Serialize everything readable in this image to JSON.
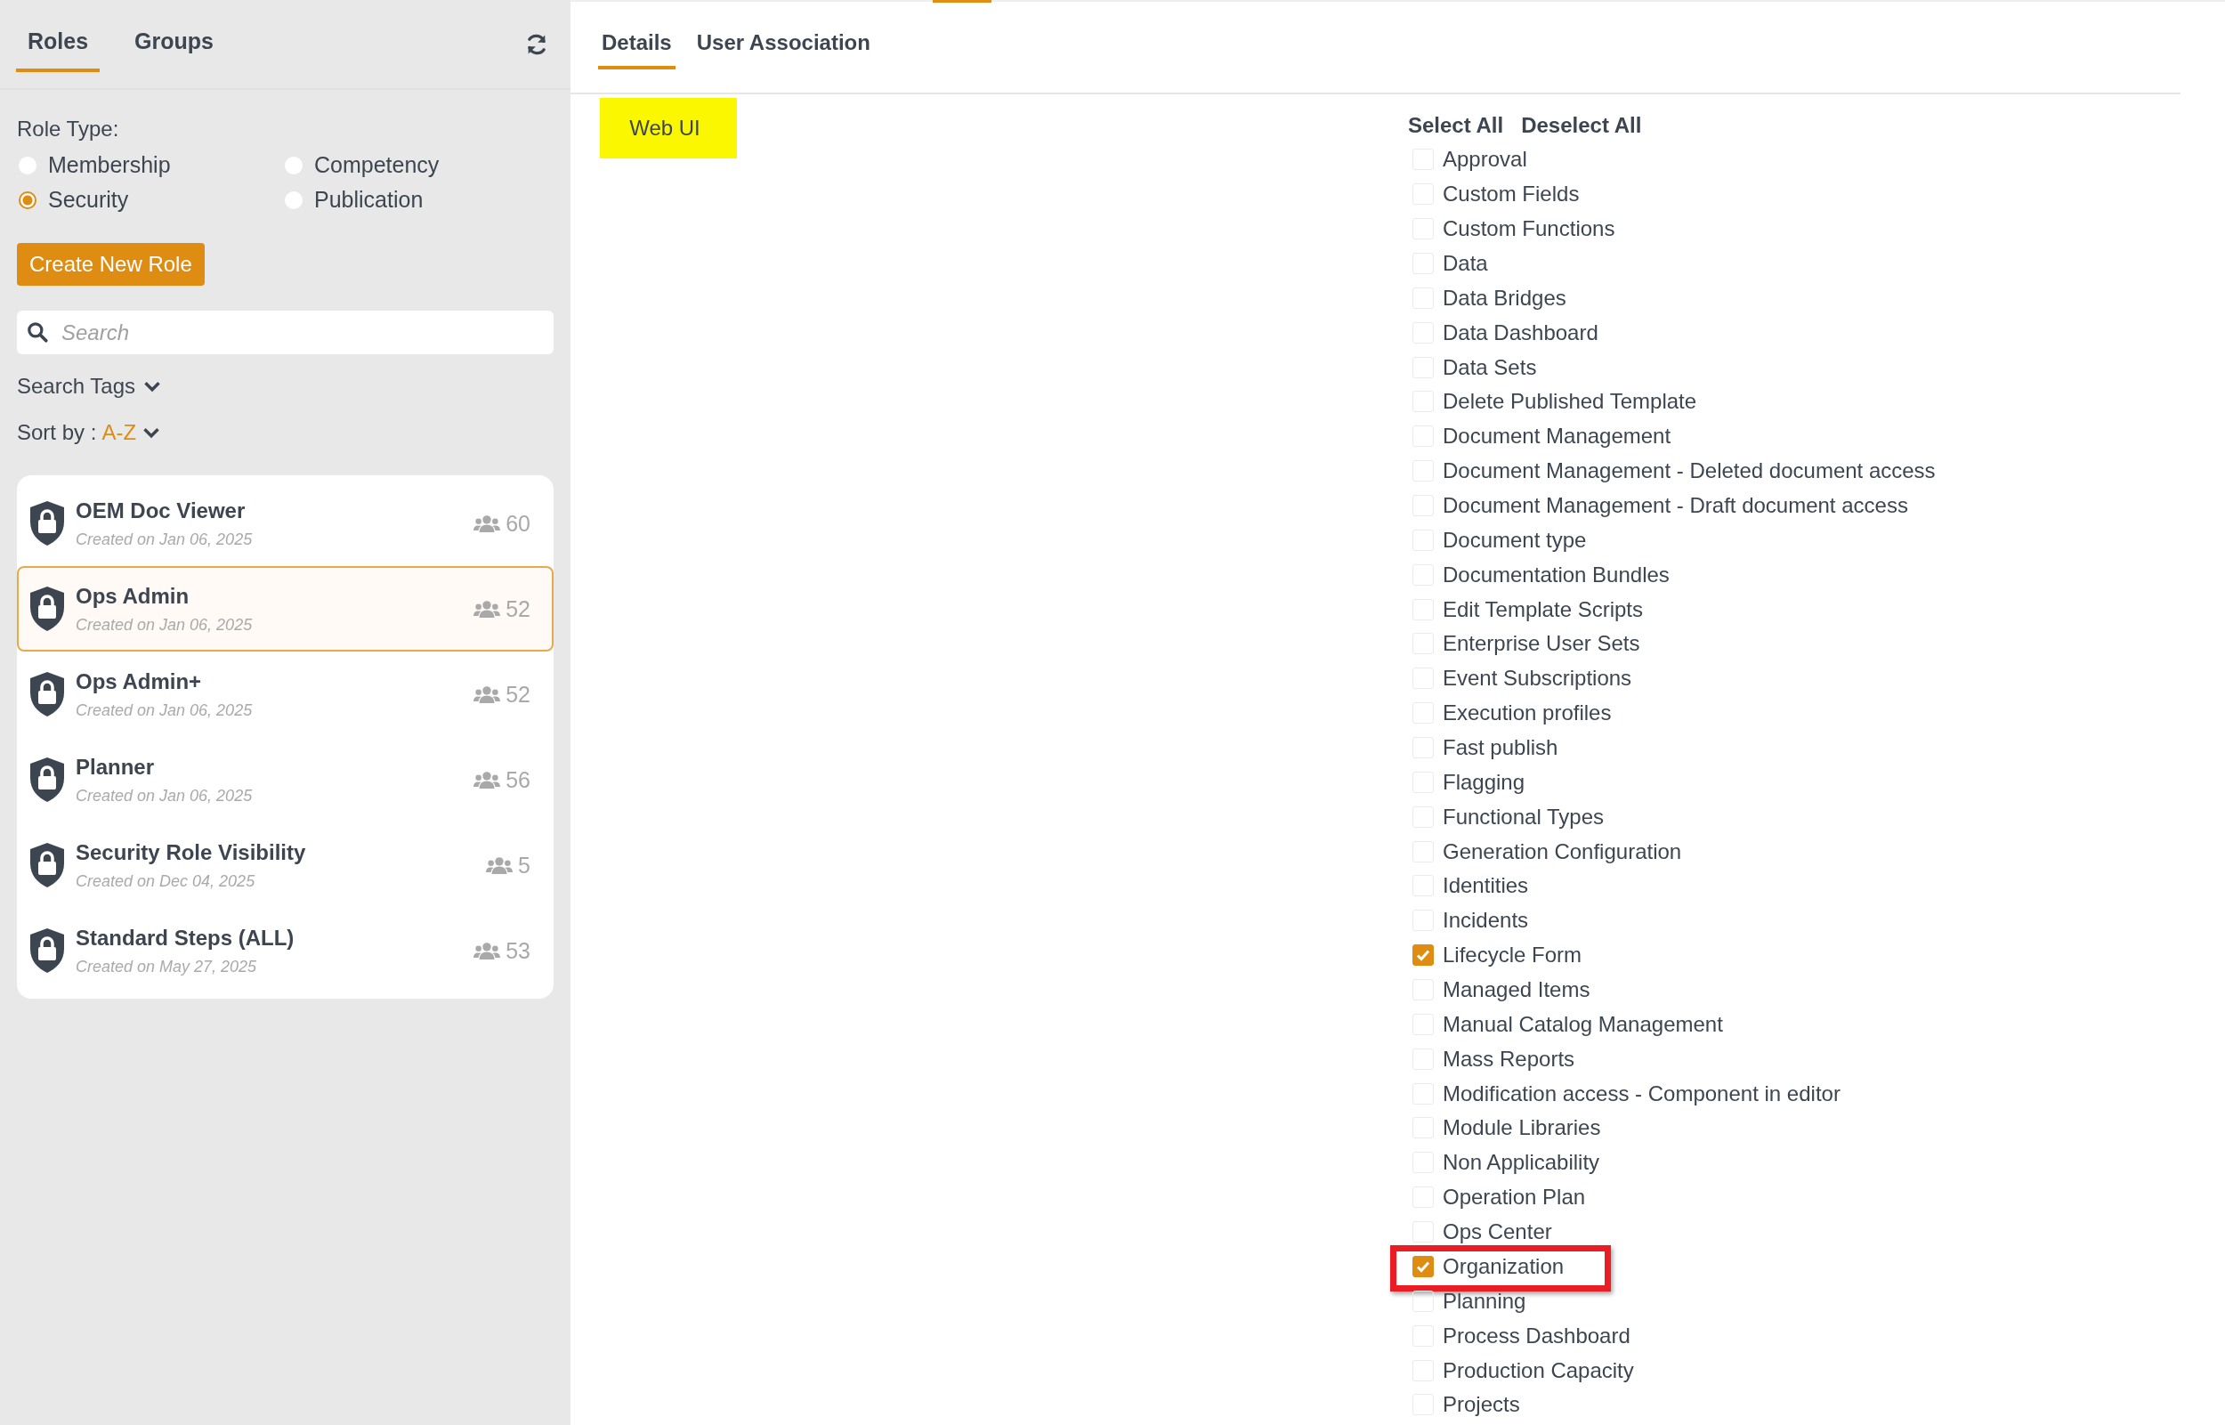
{
  "sidebar": {
    "tabs": [
      {
        "label": "Roles",
        "selected": true
      },
      {
        "label": "Groups",
        "selected": false
      }
    ],
    "role_type": {
      "label": "Role Type:",
      "options": [
        {
          "label": "Membership",
          "selected": false
        },
        {
          "label": "Competency",
          "selected": false
        },
        {
          "label": "Security",
          "selected": true
        },
        {
          "label": "Publication",
          "selected": false
        }
      ]
    },
    "create_button": "Create New Role",
    "search": {
      "placeholder": "Search"
    },
    "search_tags": "Search Tags",
    "sort": {
      "label": "Sort by :",
      "value": "A-Z"
    },
    "roles": [
      {
        "name": "OEM Doc Viewer",
        "created": "Created on Jan 06, 2025",
        "count": "60",
        "selected": false
      },
      {
        "name": "Ops Admin",
        "created": "Created on Jan 06, 2025",
        "count": "52",
        "selected": true
      },
      {
        "name": "Ops Admin+",
        "created": "Created on Jan 06, 2025",
        "count": "52",
        "selected": false
      },
      {
        "name": "Planner",
        "created": "Created on Jan 06, 2025",
        "count": "56",
        "selected": false
      },
      {
        "name": "Security Role Visibility",
        "created": "Created on Dec 04, 2025",
        "count": "5",
        "selected": false
      },
      {
        "name": "Standard Steps (ALL)",
        "created": "Created on May 27, 2025",
        "count": "53",
        "selected": false
      }
    ]
  },
  "main": {
    "tabs": [
      {
        "label": "Details",
        "selected": true
      },
      {
        "label": "User Association",
        "selected": false
      }
    ],
    "category": "Web UI",
    "select_all": "Select All",
    "deselect_all": "Deselect All",
    "permissions": [
      {
        "label": "Approval",
        "checked": false
      },
      {
        "label": "Custom Fields",
        "checked": false
      },
      {
        "label": "Custom Functions",
        "checked": false
      },
      {
        "label": "Data",
        "checked": false
      },
      {
        "label": "Data Bridges",
        "checked": false
      },
      {
        "label": "Data Dashboard",
        "checked": false
      },
      {
        "label": "Data Sets",
        "checked": false
      },
      {
        "label": "Delete Published Template",
        "checked": false
      },
      {
        "label": "Document Management",
        "checked": false
      },
      {
        "label": "Document Management - Deleted document access",
        "checked": false
      },
      {
        "label": "Document Management - Draft document access",
        "checked": false
      },
      {
        "label": "Document type",
        "checked": false
      },
      {
        "label": "Documentation Bundles",
        "checked": false
      },
      {
        "label": "Edit Template Scripts",
        "checked": false
      },
      {
        "label": "Enterprise User Sets",
        "checked": false
      },
      {
        "label": "Event Subscriptions",
        "checked": false
      },
      {
        "label": "Execution profiles",
        "checked": false
      },
      {
        "label": "Fast publish",
        "checked": false
      },
      {
        "label": "Flagging",
        "checked": false
      },
      {
        "label": "Functional Types",
        "checked": false
      },
      {
        "label": "Generation Configuration",
        "checked": false
      },
      {
        "label": "Identities",
        "checked": false
      },
      {
        "label": "Incidents",
        "checked": false
      },
      {
        "label": "Lifecycle Form",
        "checked": true
      },
      {
        "label": "Managed Items",
        "checked": false
      },
      {
        "label": "Manual Catalog Management",
        "checked": false
      },
      {
        "label": "Mass Reports",
        "checked": false
      },
      {
        "label": "Modification access - Component in editor",
        "checked": false
      },
      {
        "label": "Module Libraries",
        "checked": false
      },
      {
        "label": "Non Applicability",
        "checked": false
      },
      {
        "label": "Operation Plan",
        "checked": false
      },
      {
        "label": "Ops Center",
        "checked": false
      },
      {
        "label": "Organization",
        "checked": true,
        "highlighted": true
      },
      {
        "label": "Planning",
        "checked": false
      },
      {
        "label": "Process Dashboard",
        "checked": false
      },
      {
        "label": "Production Capacity",
        "checked": false
      },
      {
        "label": "Projects",
        "checked": false
      }
    ]
  }
}
